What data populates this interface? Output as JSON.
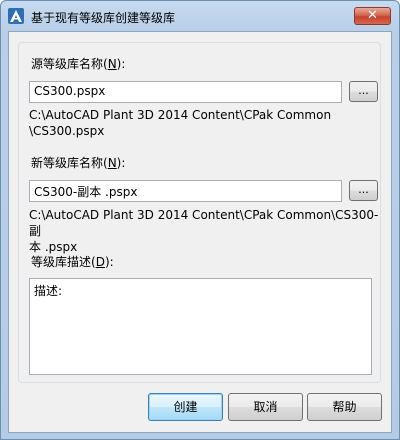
{
  "window": {
    "title": "基于现有等级库创建等级库",
    "close_label": "✕"
  },
  "source": {
    "label_text": "源等级库名称(",
    "label_key": "N",
    "label_end": "):",
    "value": "CS300.pspx",
    "browse_label": "...",
    "path_line1": "C:\\AutoCAD Plant 3D 2014 Content\\CPak Common",
    "path_line2": "\\CS300.pspx"
  },
  "target": {
    "label_text": "新等级库名称(",
    "label_key": "N",
    "label_end": "):",
    "value": "CS300-副本 .pspx",
    "browse_label": "...",
    "path_line1": "C:\\AutoCAD Plant 3D 2014 Content\\CPak Common\\CS300-副",
    "path_line2": "本 .pspx"
  },
  "description": {
    "label_text": "等级库描述(",
    "label_key": "D",
    "label_end": "):",
    "value": "描述:"
  },
  "buttons": {
    "create": "创建",
    "cancel": "取消",
    "help": "帮助"
  }
}
